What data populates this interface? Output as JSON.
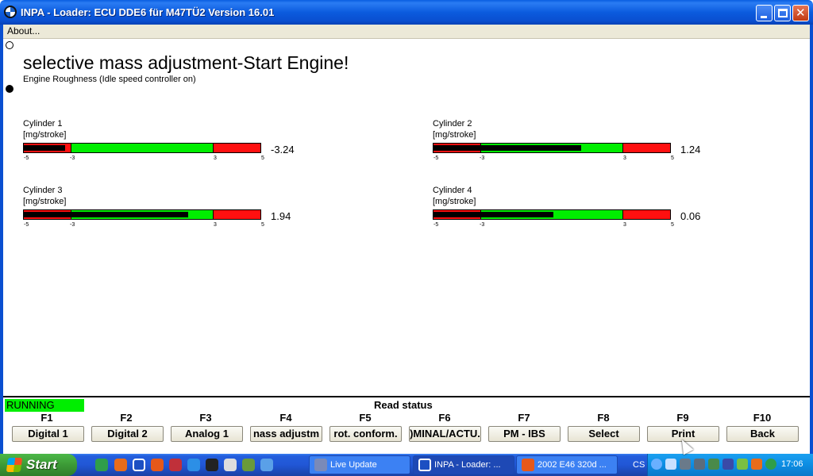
{
  "window": {
    "title": "INPA - Loader:  ECU DDE6 für M47TÜ2 Version 16.01"
  },
  "menu": {
    "about": "About..."
  },
  "main": {
    "title": "selective mass adjustment-Start Engine!",
    "subtitle": "Engine Roughness (Idle speed controller on)"
  },
  "cylinders": [
    {
      "name": "Cylinder 1",
      "unit": "[mg/stroke]",
      "value": "-3.24",
      "level": -3.24,
      "ticks": [
        "-5",
        "-3",
        "3",
        "5"
      ]
    },
    {
      "name": "Cylinder 2",
      "unit": "[mg/stroke]",
      "value": "1.24",
      "level": 1.24,
      "ticks": [
        "-5",
        "-3",
        "3",
        "5"
      ]
    },
    {
      "name": "Cylinder 3",
      "unit": "[mg/stroke]",
      "value": "1.94",
      "level": 1.94,
      "ticks": [
        "-5",
        "-3",
        "3",
        "5"
      ]
    },
    {
      "name": "Cylinder 4",
      "unit": "[mg/stroke]",
      "value": "0.06",
      "level": 0.06,
      "ticks": [
        "-5",
        "-3",
        "3",
        "5"
      ]
    }
  ],
  "gauge": {
    "min": -5,
    "max": 5,
    "low_limit": -3,
    "high_limit": 3
  },
  "status": {
    "running": "RUNNING",
    "read_status": "Read status"
  },
  "fkeys": [
    {
      "key": "F1",
      "label": "Digital 1"
    },
    {
      "key": "F2",
      "label": "Digital 2"
    },
    {
      "key": "F3",
      "label": "Analog 1"
    },
    {
      "key": "F4",
      "label": "nass adjustm"
    },
    {
      "key": "F5",
      "label": "rot. conform."
    },
    {
      "key": "F6",
      "label": ")MINAL/ACTU."
    },
    {
      "key": "F7",
      "label": "PM - IBS"
    },
    {
      "key": "F8",
      "label": "Select"
    },
    {
      "key": "F9",
      "label": "Print"
    },
    {
      "key": "F10",
      "label": "Back"
    }
  ],
  "taskbar": {
    "start": "Start",
    "tasks": [
      "Live Update",
      "INPA - Loader: ...",
      "2002 E46 320d ..."
    ],
    "lang": "CS",
    "clock": "17:06"
  },
  "colors": {
    "ok_green": "#00ee00",
    "limit_red": "#ff1010",
    "xp_blue": "#0a4fd0"
  }
}
